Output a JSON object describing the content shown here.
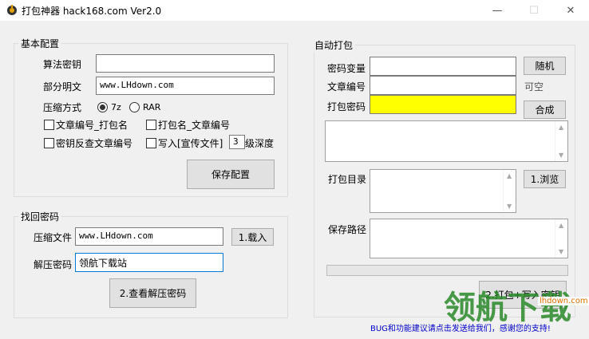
{
  "window": {
    "title": "打包神器 hack168.com Ver2.0",
    "min": "—",
    "max": "☐",
    "close": "✕"
  },
  "basic": {
    "legend": "基本配置",
    "algo_key_label": "算法密钥",
    "algo_key_value": "",
    "partial_text_label": "部分明文",
    "partial_text_value": "www.LHdown.com",
    "compress_label": "压缩方式",
    "opt_7z": "7z",
    "opt_rar": "RAR",
    "cb1": "文章编号_打包名",
    "cb2": "打包名_文章编号",
    "cb3": "密钥反查文章编号",
    "cb4": "写入[宣传文件]",
    "depth_value": "3",
    "depth_label": "级深度",
    "save_btn": "保存配置"
  },
  "recover": {
    "legend": "找回密码",
    "file_label": "压缩文件",
    "file_value": "www.LHdown.com",
    "load_btn": "1.载入",
    "pwd_label": "解压密码",
    "pwd_value": "领航下载站",
    "check_btn": "2.查看解压密码"
  },
  "auto": {
    "legend": "自动打包",
    "pwd_var_label": "密码变量",
    "random_btn": "随机",
    "article_label": "文章编号",
    "optional_text": "可空",
    "pack_pwd_label": "打包密码",
    "combine_btn": "合成",
    "dir_label": "打包目录",
    "browse_btn": "1.浏览",
    "save_path_label": "保存路径",
    "pack_btn": "2.打包+写入密钥"
  },
  "status": "BUG和功能建议请点击发送给我们，感谢您的支持!",
  "watermark": {
    "text": "领航下载",
    "site": "lhdown.com"
  },
  "colors": {
    "highlight": "#ffff00",
    "status_text": "#0000cc"
  }
}
